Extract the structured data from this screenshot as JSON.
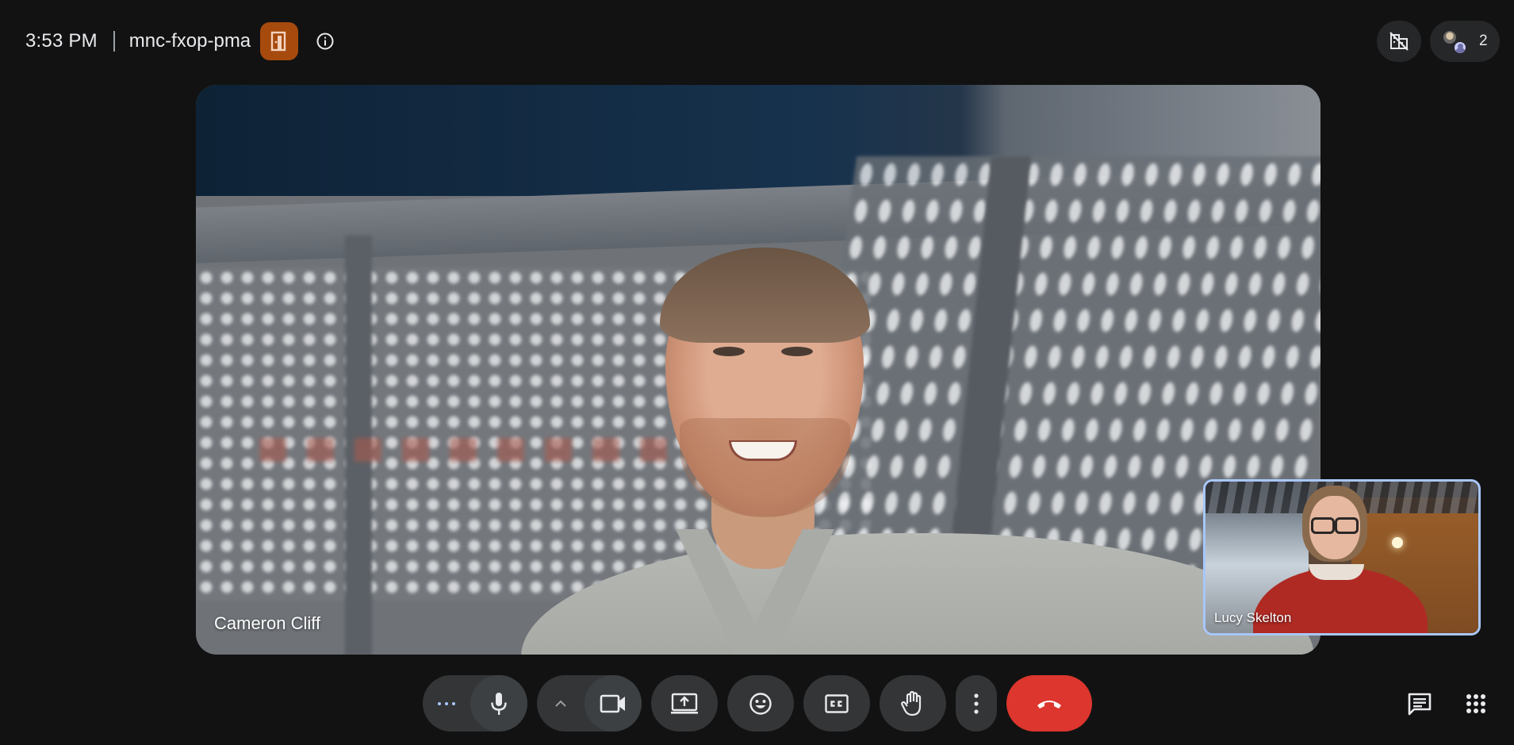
{
  "header": {
    "time": "3:53 PM",
    "meeting_code": "mnc-fxop-pma",
    "host_controls_icon": "host-controls-icon",
    "info_icon": "info-icon"
  },
  "top_right": {
    "visual_effects_icon": "domain-disabled-icon",
    "people_count": "2"
  },
  "main_video": {
    "participant_name": "Cameron Cliff"
  },
  "self_view": {
    "participant_name": "Lucy Skelton"
  },
  "controls": {
    "icons": [
      "more-horiz-icon",
      "mic-icon",
      "chevron-up-icon",
      "videocam-icon",
      "present-screen-icon",
      "emoji-icon",
      "closed-captions-icon",
      "raise-hand-icon",
      "more-vert-icon",
      "call-end-icon"
    ],
    "end_call_color": "#dc362e"
  },
  "bottom_right": {
    "icons": [
      "chat-icon",
      "activities-grid-icon"
    ]
  },
  "colors": {
    "background": "#121212",
    "button": "#333537",
    "host_badge": "#a64a0d",
    "self_view_border": "#a8c7fa"
  }
}
